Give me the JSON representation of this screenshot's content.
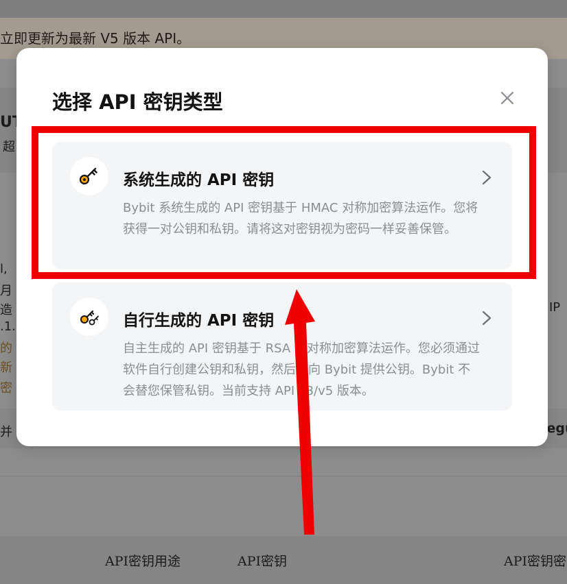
{
  "background": {
    "notice_text": "立即更新为最新 V5 版本 API。",
    "fragments": [
      "UT",
      "超",
      "l,",
      "月",
      "造",
      ".1.",
      "的",
      "新",
      "密",
      "并",
      "IP",
      "legu"
    ],
    "footer_links": [
      "API密钥用途",
      "API密钥",
      "API密钥密"
    ]
  },
  "modal": {
    "title": "选择 API 密钥类型",
    "close_icon": "close-icon",
    "options": [
      {
        "title": "系统生成的 API 密钥",
        "description": "Bybit 系统生成的 API 密钥基于 HMAC 对称加密算法运作。您将获得一对公钥和私钥。请将这对密钥视为密码一样妥善保管。",
        "icon": "key-icon"
      },
      {
        "title": "自行生成的 API 密钥",
        "description": "自主生成的 API 密钥基于 RSA 非对称加密算法运作。您必须通过软件自行创建公钥和私钥，然后仅向 Bybit 提供公钥。Bybit 不会替您保管私钥。当前支持 API v3/v5 版本。",
        "icon": "keys-icon"
      }
    ]
  },
  "annotation": {
    "color": "#ee0000"
  }
}
